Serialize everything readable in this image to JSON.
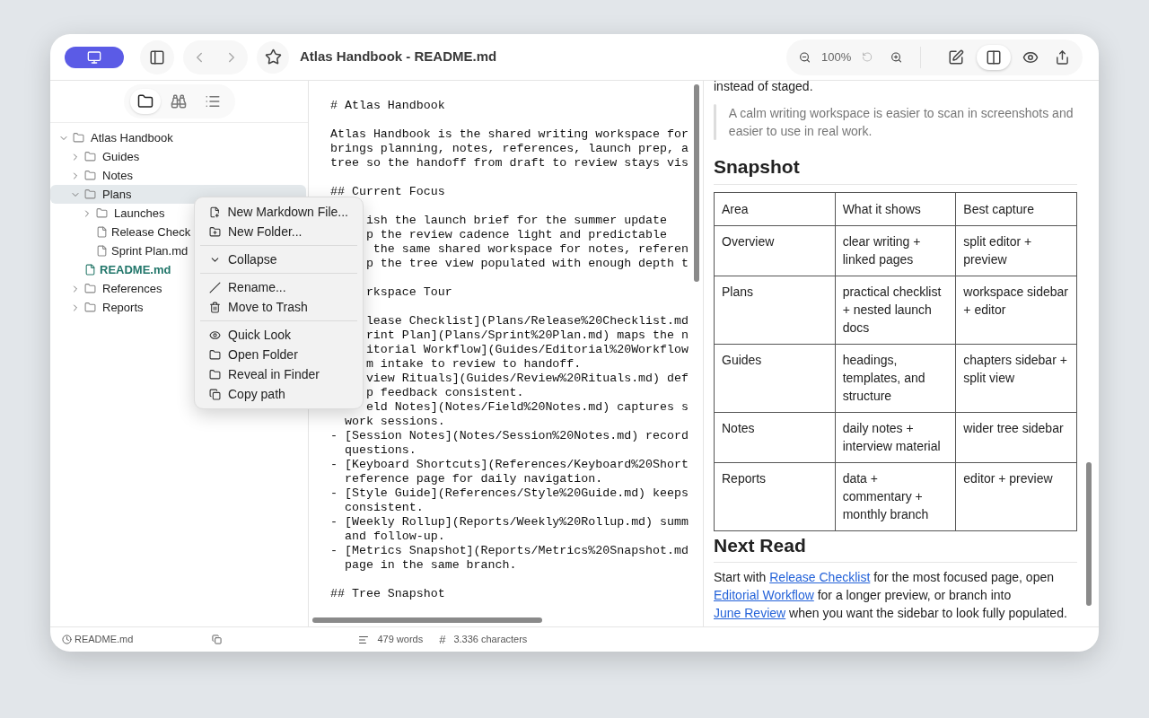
{
  "toolbar": {
    "title": "Atlas Handbook - README.md",
    "zoom": "100%",
    "view_modes": [
      {
        "selected": false
      },
      {
        "selected": true
      },
      {
        "selected": false
      }
    ]
  },
  "sidebar": {
    "tabs": [
      {
        "selected": true
      },
      {
        "selected": false
      },
      {
        "selected": false
      }
    ],
    "tree": [
      {
        "label": "Atlas Handbook",
        "kind": "folder",
        "expanded": true,
        "selected": false,
        "current": false,
        "children": [
          {
            "label": "Guides",
            "kind": "folder",
            "expanded": false,
            "selected": false,
            "current": false
          },
          {
            "label": "Notes",
            "kind": "folder",
            "expanded": false,
            "selected": false,
            "current": false
          },
          {
            "label": "Plans",
            "kind": "folder",
            "expanded": true,
            "selected": true,
            "current": false,
            "children": [
              {
                "label": "Launches",
                "kind": "folder",
                "expanded": false,
                "selected": false,
                "current": false
              },
              {
                "label": "Release Check",
                "kind": "file",
                "selected": false,
                "current": false
              },
              {
                "label": "Sprint Plan.md",
                "kind": "file",
                "selected": false,
                "current": false
              }
            ]
          },
          {
            "label": "README.md",
            "kind": "file",
            "selected": false,
            "current": true
          },
          {
            "label": "References",
            "kind": "folder",
            "expanded": false,
            "selected": false,
            "current": false
          },
          {
            "label": "Reports",
            "kind": "folder",
            "expanded": false,
            "selected": false,
            "current": false
          }
        ]
      }
    ]
  },
  "context_menu": {
    "groups": [
      [
        "New Markdown File...",
        "New Folder..."
      ],
      [
        "Collapse"
      ],
      [
        "Rename...",
        "Move to Trash"
      ],
      [
        "Quick Look",
        "Open Folder",
        "Reveal in Finder",
        "Copy path"
      ]
    ]
  },
  "editor": {
    "blocks": [
      [
        {
          "text": "# Atlas Handbook",
          "covered": false
        }
      ],
      [
        {
          "text": "Atlas Handbook is the shared writing workspace for",
          "covered": false
        },
        {
          "text": "brings planning, notes, references, launch prep, a",
          "covered": false
        },
        {
          "text": "tree so the handoff from draft to review stays vis",
          "covered": false
        }
      ],
      [
        {
          "text": "## Current Focus",
          "covered": false
        }
      ],
      [
        {
          "text": "ish the launch brief for the summer update",
          "covered": true
        },
        {
          "text": "p the review cadence light and predictable",
          "covered": true
        },
        {
          "text": " the same shared workspace for notes, referen",
          "covered": true
        },
        {
          "text": "p the tree view populated with enough depth t",
          "covered": true
        }
      ],
      [
        {
          "text": "rkspace Tour",
          "covered": true
        }
      ],
      [
        {
          "text": "lease Checklist](Plans/Release%20Checklist.md",
          "covered": true
        },
        {
          "text": "rint Plan](Plans/Sprint%20Plan.md) maps the n",
          "covered": true
        },
        {
          "text": "itorial Workflow](Guides/Editorial%20Workflow",
          "covered": true
        },
        {
          "text": "m intake to review to handoff.",
          "covered": true
        },
        {
          "text": "view Rituals](Guides/Review%20Rituals.md) def",
          "covered": true
        },
        {
          "text": "p feedback consistent.",
          "covered": true
        },
        {
          "text": "eld Notes](Notes/Field%20Notes.md) captures s",
          "covered": true
        },
        {
          "text": "  work sessions.",
          "covered": false
        },
        {
          "text": "- [Session Notes](Notes/Session%20Notes.md) record",
          "covered": false
        },
        {
          "text": "  questions.",
          "covered": false
        },
        {
          "text": "- [Keyboard Shortcuts](References/Keyboard%20Short",
          "covered": false
        },
        {
          "text": "  reference page for daily navigation.",
          "covered": false
        },
        {
          "text": "- [Style Guide](References/Style%20Guide.md) keeps",
          "covered": false
        },
        {
          "text": "  consistent.",
          "covered": false
        },
        {
          "text": "- [Weekly Rollup](Reports/Weekly%20Rollup.md) summ",
          "covered": false
        },
        {
          "text": "  and follow-up.",
          "covered": false
        },
        {
          "text": "- [Metrics Snapshot](Reports/Metrics%20Snapshot.md",
          "covered": false
        },
        {
          "text": "  page in the same branch.",
          "covered": false
        }
      ],
      [
        {
          "text": "## Tree Snapshot",
          "covered": false
        }
      ]
    ]
  },
  "preview": {
    "top_text": "instead of staged.",
    "quote": "A calm writing workspace is easier to scan in screenshots and easier to use in real work.",
    "heading": "Snapshot",
    "table": {
      "columns": [
        "Area",
        "What it shows",
        "Best capture"
      ],
      "rows": [
        [
          "Overview",
          "clear writing + linked pages",
          "split editor + preview"
        ],
        [
          "Plans",
          "practical checklist + nested launch docs",
          "workspace sidebar + editor"
        ],
        [
          "Guides",
          "headings, templates, and structure",
          "chapters sidebar + split view"
        ],
        [
          "Notes",
          "daily notes + interview material",
          "wider tree sidebar"
        ],
        [
          "Reports",
          "data + commentary + monthly branch",
          "editor + preview"
        ]
      ]
    },
    "heading_2": "Next Read",
    "paragraph": [
      {
        "kind": "text",
        "text": "Start with "
      },
      {
        "kind": "link",
        "text": "Release Checklist"
      },
      {
        "kind": "text",
        "text": " for the most focused page, open "
      },
      {
        "kind": "link",
        "text": "Editorial Workflow"
      },
      {
        "kind": "text",
        "text": " for a longer preview, or branch into "
      },
      {
        "kind": "link",
        "text": "June Review"
      },
      {
        "kind": "text",
        "text": " when you want the sidebar to look fully populated."
      }
    ]
  },
  "status_bar": {
    "file": "README.md",
    "words": "479 words",
    "hash": "#",
    "characters": "3.336 characters"
  }
}
